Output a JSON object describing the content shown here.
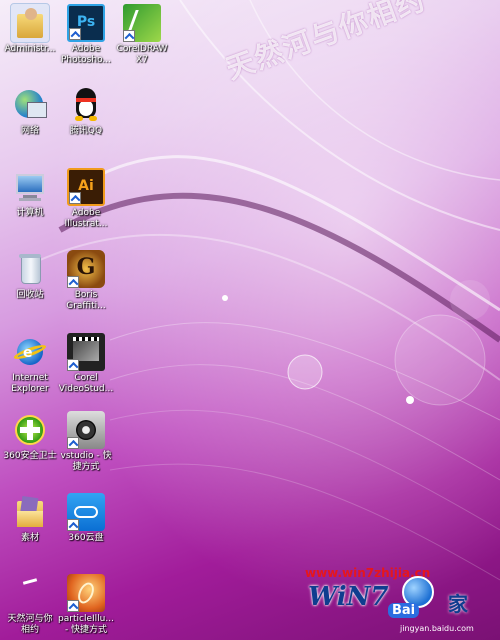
{
  "desktop": {
    "icons": [
      {
        "name": "administrator-folder-icon",
        "label": "Administr..."
      },
      {
        "name": "photoshop-icon",
        "label": "Adobe\nPhotosho..."
      },
      {
        "name": "coreldraw-icon",
        "label": "CorelDRAW\nX7"
      },
      {
        "name": "network-icon",
        "label": "网络"
      },
      {
        "name": "qq-icon",
        "label": "腾讯QQ"
      },
      {
        "name": "computer-icon",
        "label": "计算机"
      },
      {
        "name": "illustrator-icon",
        "label": "Adobe\nIllustrat..."
      },
      {
        "name": "recycle-bin-icon",
        "label": "回收站"
      },
      {
        "name": "boris-graffiti-icon",
        "label": "Boris\nGraffiti..."
      },
      {
        "name": "internet-explorer-icon",
        "label": "Internet\nExplorer"
      },
      {
        "name": "corel-videostudio-icon",
        "label": "Corel\nVideoStud..."
      },
      {
        "name": "360-security-icon",
        "label": "360安全卫士"
      },
      {
        "name": "vstudio-shortcut-icon",
        "label": "vstudio - 快\n捷方式"
      },
      {
        "name": "material-folder-icon",
        "label": "素材"
      },
      {
        "name": "360-cloud-icon",
        "label": "360云盘"
      },
      {
        "name": "document-icon",
        "label": "天然河与你\n相约"
      },
      {
        "name": "particle-shortcut-icon",
        "label": "particleIllu...\n- 快捷方式"
      }
    ]
  },
  "overlays": {
    "watermark": "天然河与你相约",
    "site_url": "www.win7zhijia.cn",
    "brand": "WiN7",
    "brand_tag": "Bai",
    "brand_jia": "家",
    "source": "jingyan.baidu.com"
  }
}
